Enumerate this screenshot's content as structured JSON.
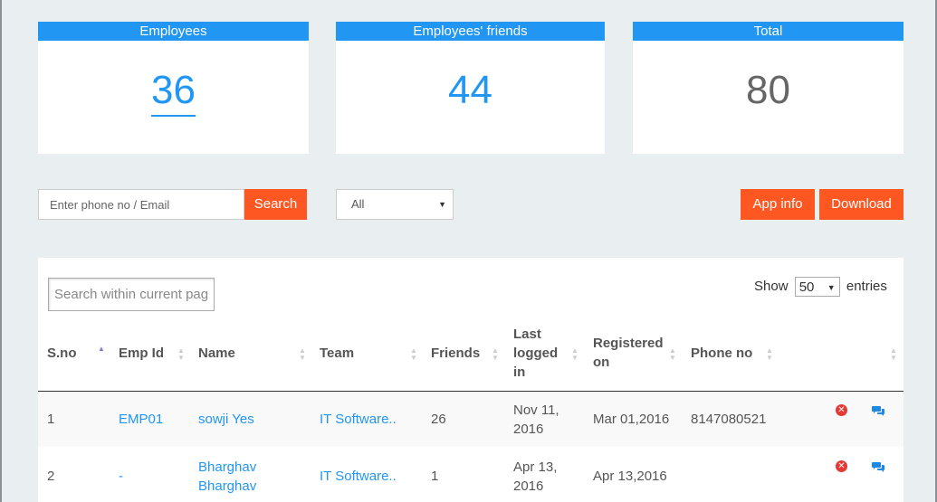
{
  "stats": {
    "employees": {
      "label": "Employees",
      "value": "36"
    },
    "friends": {
      "label": "Employees' friends",
      "value": "44"
    },
    "total": {
      "label": "Total",
      "value": "80"
    }
  },
  "controls": {
    "search_placeholder": "Enter phone no / Email",
    "search_button": "Search",
    "filter_value": "All",
    "app_info_button": "App info",
    "download_button": "Download"
  },
  "table": {
    "search_placeholder": "Search within current page",
    "show_label": "Show",
    "entries_value": "50",
    "entries_label": "entries",
    "columns": {
      "sno": "S.no",
      "emp_id": "Emp Id",
      "name": "Name",
      "team": "Team",
      "friends": "Friends",
      "last_logged_1": "Last",
      "last_logged_2": "logged",
      "last_logged_3": "in",
      "registered_1": "Registered",
      "registered_2": "on",
      "phone": "Phone no"
    },
    "rows": [
      {
        "sno": "1",
        "emp_id": "EMP01",
        "name_1": "sowji Yes",
        "name_2": "",
        "team": "IT Software..",
        "friends": "26",
        "last_1": "Nov 11,",
        "last_2": "2016",
        "registered": "Mar 01,2016",
        "phone": "8147080521"
      },
      {
        "sno": "2",
        "emp_id": "-",
        "name_1": "Bharghav",
        "name_2": "Bharghav",
        "team": "IT Software..",
        "friends": "1",
        "last_1": "Apr 13,",
        "last_2": "2016",
        "registered": "Apr 13,2016",
        "phone": ""
      }
    ]
  },
  "colors": {
    "card_header": "#2196f3",
    "accent_button": "#ff5722",
    "delete_icon": "#e53935",
    "link": "#2196f3"
  }
}
